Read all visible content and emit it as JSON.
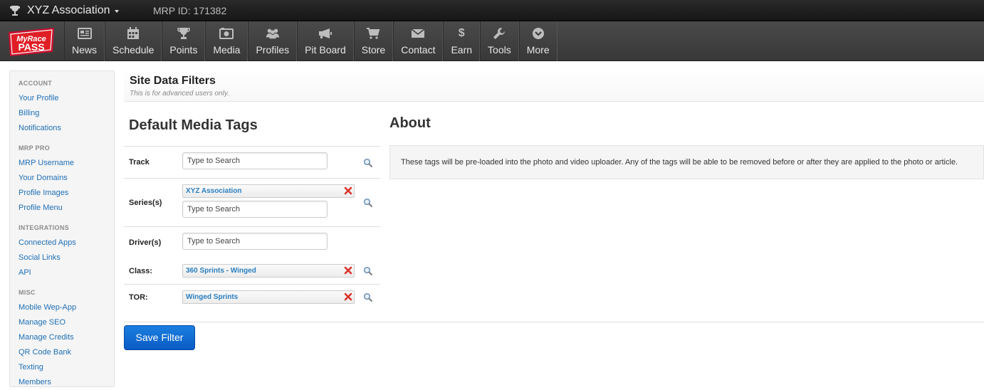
{
  "topbar": {
    "org_name": "XYZ Association",
    "mrp_id": "MRP ID: 171382"
  },
  "logo": {
    "line1": "MyRace",
    "line2": "PASS"
  },
  "nav": [
    {
      "label": "News",
      "icon": "newspaper-icon"
    },
    {
      "label": "Schedule",
      "icon": "calendar-icon"
    },
    {
      "label": "Points",
      "icon": "trophy-icon"
    },
    {
      "label": "Media",
      "icon": "camera-icon"
    },
    {
      "label": "Profiles",
      "icon": "users-icon"
    },
    {
      "label": "Pit Board",
      "icon": "megaphone-icon"
    },
    {
      "label": "Store",
      "icon": "cart-icon"
    },
    {
      "label": "Contact",
      "icon": "envelope-icon"
    },
    {
      "label": "Earn",
      "icon": "dollar-icon"
    },
    {
      "label": "Tools",
      "icon": "wrench-icon"
    },
    {
      "label": "More",
      "icon": "chevron-circle-icon"
    }
  ],
  "sidebar": {
    "sections": [
      {
        "title": "ACCOUNT",
        "items": [
          "Your Profile",
          "Billing",
          "Notifications"
        ]
      },
      {
        "title": "MRP PRO",
        "items": [
          "MRP Username",
          "Your Domains",
          "Profile Images",
          "Profile Menu"
        ]
      },
      {
        "title": "INTEGRATIONS",
        "items": [
          "Connected Apps",
          "Social Links",
          "API"
        ]
      },
      {
        "title": "MISC",
        "items": [
          "Mobile Wep-App",
          "Manage SEO",
          "Manage Credits",
          "QR Code Bank",
          "Texting",
          "Members"
        ]
      }
    ]
  },
  "page": {
    "title": "Site Data Filters",
    "subtitle": "This is for advanced users only."
  },
  "filters": {
    "title": "Default Media Tags",
    "placeholder": "Type to Search",
    "track_label": "Track",
    "series_label": "Series(s)",
    "series_tag": "XYZ Association",
    "drivers_label": "Driver(s)",
    "class_label": "Class:",
    "class_tag": "360 Sprints - Winged",
    "tor_label": "TOR:",
    "tor_tag": "Winged Sprints",
    "save_label": "Save Filter"
  },
  "about": {
    "title": "About",
    "text": "These tags will be pre-loaded into the photo and video uploader. Any of the tags will be able to be removed before or after they are applied to the photo or article."
  },
  "colors": {
    "link": "#1e6fb5",
    "tag_text": "#2a7fc0",
    "primary_button": "#0a5bc4",
    "remove_x": "#d9342b"
  }
}
